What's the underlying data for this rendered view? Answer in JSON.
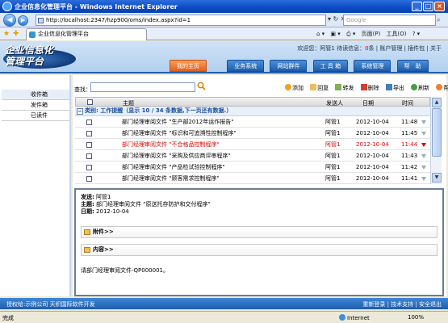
{
  "window": {
    "title": "企业信息化管理平台 - Windows Internet Explorer"
  },
  "addressbar": {
    "url": "http://localhost:2347/hzp900/oms/index.aspx?id=1",
    "search_placeholder": "Google"
  },
  "browser_tab": {
    "title": "企业信息化管理平台"
  },
  "ie_tools": {
    "home": "",
    "print": "",
    "page": "页面(P)",
    "tools": "工具(O)",
    "help": ""
  },
  "app": {
    "logo_line1": "企业信息化",
    "logo_line2": "管理平台",
    "welcome_prefix": "欢迎您：",
    "user": "阿管1",
    "msg_text": "待读信息：",
    "msg_count": "0",
    "msg_suffix": "条",
    "links": [
      "账户管理",
      "插件包",
      "关于"
    ]
  },
  "nav": {
    "items": [
      {
        "label": "我的主页",
        "active": true
      },
      {
        "label": "业务系统",
        "active": false
      },
      {
        "label": "网站群件",
        "active": false
      },
      {
        "label": "工 具 箱",
        "active": false
      },
      {
        "label": "系统管理",
        "active": false
      },
      {
        "label": "帮　助",
        "active": false
      }
    ]
  },
  "sidebar": {
    "items": [
      {
        "label": "收件箱",
        "active": true
      },
      {
        "label": "发件箱",
        "active": false
      },
      {
        "label": "已读件",
        "active": false
      }
    ]
  },
  "toolbar": {
    "search_label": "查找：",
    "actions": [
      "添加",
      "回复",
      "转发",
      "删除",
      "导出",
      "刷新",
      "帮助"
    ]
  },
  "grid": {
    "headers": {
      "subject": "主题",
      "sender": "发送人",
      "date": "日期",
      "time": "时间"
    },
    "category": "类别: 工作提醒（显示 10 / 34 条数据,下一页还有数据.）",
    "rows": [
      {
        "subject": "部门经理审阅文件 \"生产部2012年运作报告\"",
        "sender": "阿管1",
        "date": "2012-10-04",
        "time": "11:48",
        "urgent": false
      },
      {
        "subject": "部门经理审阅文件 \"标识和可追溯性控制程序\"",
        "sender": "阿管1",
        "date": "2012-10-04",
        "time": "11:45",
        "urgent": false
      },
      {
        "subject": "部门经理审阅文件 \"不合格品控制程序\"",
        "sender": "阿管1",
        "date": "2012-10-04",
        "time": "11:44",
        "urgent": true
      },
      {
        "subject": "部门经理审阅文件 \"采购及供应商评审程序\"",
        "sender": "阿管1",
        "date": "2012-10-04",
        "time": "11:43",
        "urgent": false
      },
      {
        "subject": "部门经理审阅文件 \"产品检试验控制程序\"",
        "sender": "阿管1",
        "date": "2012-10-04",
        "time": "11:42",
        "urgent": false
      },
      {
        "subject": "部门经理审阅文件 \"顾客需求控制程序\"",
        "sender": "阿管1",
        "date": "2012-10-04",
        "time": "11:41",
        "urgent": false
      }
    ]
  },
  "preview": {
    "from_label": "发送:",
    "from": "阿管1",
    "subject_label": "主题:",
    "subject": "部门经理审阅文件 \"原送托存防护和交付程序\"",
    "date_label": "日期:",
    "date": "2012-10-04",
    "attachments": "附件>>",
    "content": "内容>>",
    "body": "请部门经理审阅文件-QP000001。"
  },
  "footer": {
    "left": "授权给:示例公司  天织国际软件开发",
    "right_links": [
      "重新登录",
      "技术支持",
      "安全退出"
    ]
  },
  "statusbar": {
    "status": "完成",
    "zone": "Internet",
    "zoom": "100%"
  },
  "colors": {
    "nav_blue": "#1d5cab",
    "active_tab": "#e0601a",
    "urgent_text": "#e00000",
    "category_text": "#1a4fa3"
  }
}
